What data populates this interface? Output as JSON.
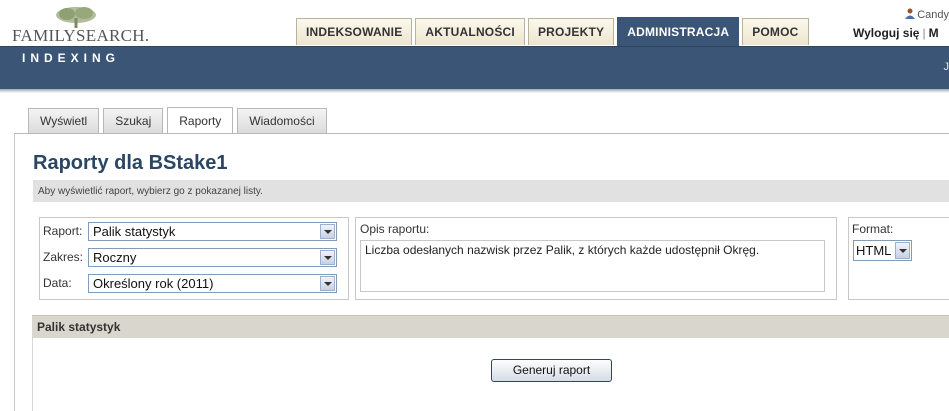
{
  "brand": {
    "name": "FamilySearch",
    "logo_text": "FAMILYSEARCH.",
    "subtitle": "INDEXING"
  },
  "nav": {
    "tabs": [
      {
        "label": "INDEKSOWANIE",
        "active": false
      },
      {
        "label": "AKTUALNOŚCI",
        "active": false
      },
      {
        "label": "PROJEKTY",
        "active": false
      },
      {
        "label": "ADMINISTRACJA",
        "active": true
      },
      {
        "label": "POMOC",
        "active": false
      }
    ]
  },
  "user": {
    "name": "Candy",
    "logout": "Wyloguj się",
    "next_link_fragment": "M",
    "banner_right": "J"
  },
  "subtabs": [
    {
      "label": "Wyświetl",
      "active": false
    },
    {
      "label": "Szukaj",
      "active": false
    },
    {
      "label": "Raporty",
      "active": true
    },
    {
      "label": "Wiadomości",
      "active": false
    }
  ],
  "page": {
    "title": "Raporty dla BStake1",
    "instructions": "Aby wyświetlić raport, wybierz go z pokazanej listy."
  },
  "form": {
    "report_label": "Raport:",
    "report_value": "Palik statystyk",
    "range_label": "Zakres:",
    "range_value": "Roczny",
    "date_label": "Data:",
    "date_value": "Określony rok (2011)"
  },
  "description": {
    "label": "Opis raportu:",
    "text": "Liczba odesłanych nazwisk przez Palik, z których każde udostępnił Okręg."
  },
  "format": {
    "label": "Format:",
    "value": "HTML"
  },
  "section": {
    "title": "Palik statystyk",
    "generate_button": "Generuj raport"
  },
  "colors": {
    "banner": "#3a5575",
    "title_text": "#2b4663",
    "section_bg": "#d9d6cd"
  }
}
